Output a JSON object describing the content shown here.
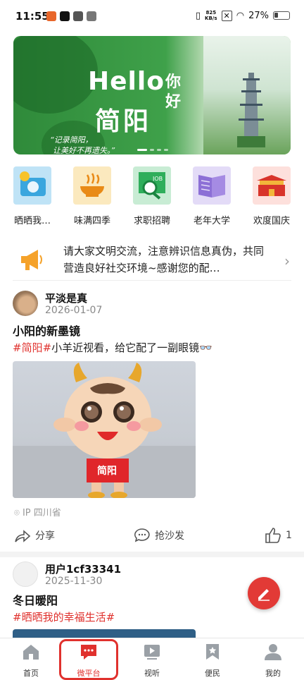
{
  "status_bar": {
    "time": "11:55",
    "net_speed_value": "825",
    "net_speed_unit": "KB/s",
    "battery": "27%"
  },
  "banner": {
    "hello": "Hello",
    "nihao": "你好",
    "city": "简阳",
    "slogan_line1": "“记录简阳，",
    "slogan_line2": "让美好不再遗失。”"
  },
  "categories": [
    {
      "label": "晒晒我…",
      "icon": "camera-sun-icon"
    },
    {
      "label": "味满四季",
      "icon": "bowl-icon"
    },
    {
      "label": "求职招聘",
      "icon": "job-search-icon"
    },
    {
      "label": "老年大学",
      "icon": "book-icon"
    },
    {
      "label": "欢度国庆",
      "icon": "gate-icon"
    }
  ],
  "notice": {
    "text": "请大家文明交流，注意辨识信息真伪，共同营造良好社交环境~感谢您的配…"
  },
  "post1": {
    "user": "平淡是真",
    "date": "2026-01-07",
    "title": "小阳的新墨镜",
    "tag": "#简阳#",
    "body": "小羊近视看，给它配了一副眼镜👓",
    "shirt_text": "简阳",
    "ip": "IP 四川省",
    "share": "分享",
    "comment": "抢沙发",
    "likes": "1"
  },
  "post2": {
    "user": "用户1cf33341",
    "date": "2025-11-30",
    "title": "冬日暖阳",
    "tag": "#晒晒我的幸福生活#"
  },
  "nav": [
    {
      "label": "首页"
    },
    {
      "label": "微平台"
    },
    {
      "label": "视听"
    },
    {
      "label": "便民"
    },
    {
      "label": "我的"
    }
  ]
}
